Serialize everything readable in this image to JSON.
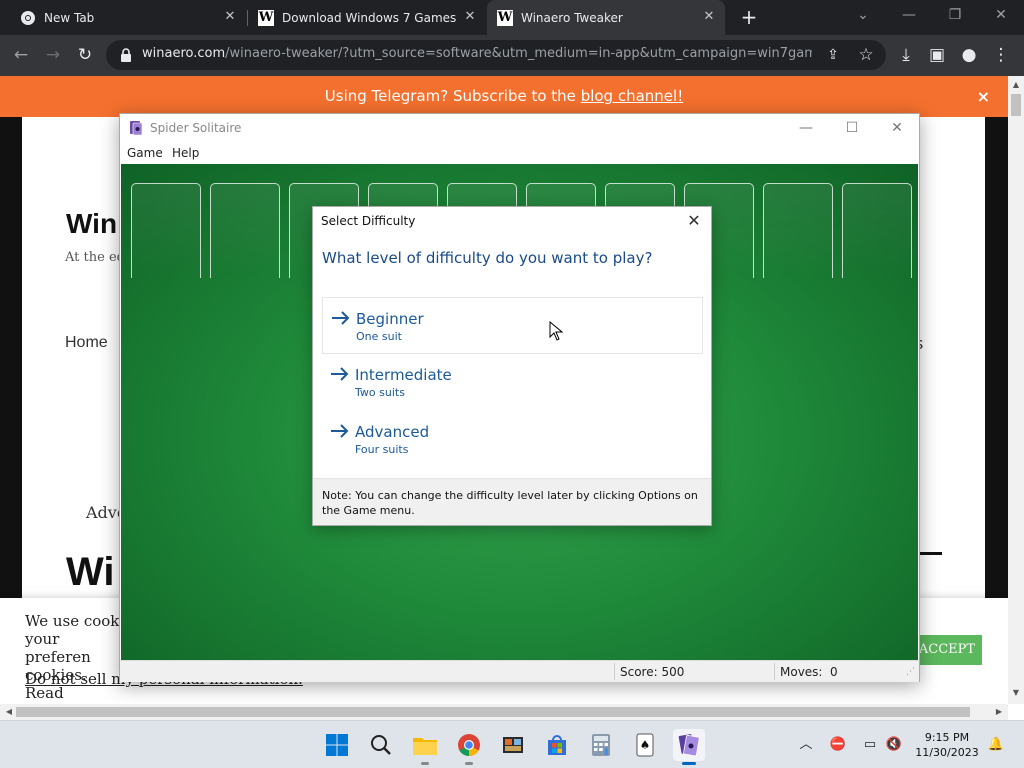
{
  "browser": {
    "tabs": [
      {
        "title": "New Tab",
        "icon": "chrome-icon",
        "active": false
      },
      {
        "title": "Download Windows 7 Games fo",
        "icon": "winaero-w-icon",
        "active": false
      },
      {
        "title": "Winaero Tweaker",
        "icon": "winaero-w-icon",
        "active": true
      }
    ],
    "url_host": "winaero.com",
    "url_path": "/winaero-tweaker/?utm_source=software&utm_medium=in-app&utm_campaign=win7games..."
  },
  "page": {
    "banner_text": "Using Telegram? Subscribe to the ",
    "banner_link": "blog channel!",
    "banner_close": "×",
    "site_title": "Win",
    "site_desc": "At the ed",
    "nav_home": "Home",
    "nav_right": "s",
    "adv_text": "Adve",
    "big_title": "Wi",
    "cookie_text": "We use cooki your preferen cookies. Read",
    "cookie_dns": "Do not sell my personal information.",
    "accept_label": "ACCEPT"
  },
  "solitaire": {
    "title": "Spider Solitaire",
    "menu": [
      "Game",
      "Help"
    ],
    "score_label": "Score: 500",
    "moves_label": "Moves:",
    "moves_value": "0",
    "slot_count": 10
  },
  "dialog": {
    "title": "Select Difficulty",
    "question": "What level of difficulty do you want to play?",
    "options": [
      {
        "name": "Beginner",
        "sub": "One suit"
      },
      {
        "name": "Intermediate",
        "sub": "Two suits"
      },
      {
        "name": "Advanced",
        "sub": "Four suits"
      }
    ],
    "note": "Note: You can change the difficulty level later by clicking Options on the Game menu."
  },
  "taskbar": {
    "time": "9:15 PM",
    "date": "11/30/2023"
  },
  "colors": {
    "banner": "#f4702e",
    "felt": "#1f8a3a",
    "link_blue": "#1c5a99",
    "accept": "#5cb85c"
  }
}
